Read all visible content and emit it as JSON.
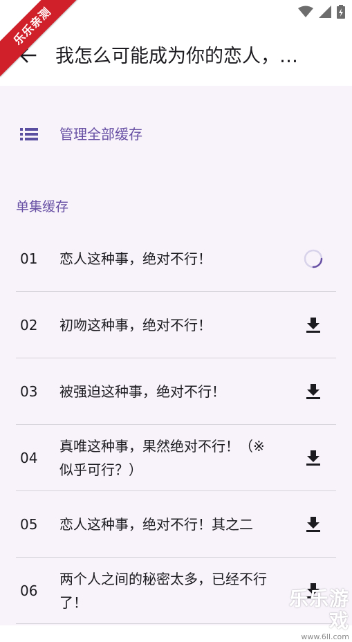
{
  "ribbon": {
    "text": "乐乐亲测"
  },
  "appbar": {
    "title": "我怎么可能成为你的恋人，…"
  },
  "manage": {
    "label": "管理全部缓存"
  },
  "section": {
    "title": "单集缓存"
  },
  "episodes": [
    {
      "num": "01",
      "title": "恋人这种事，绝对不行！",
      "state": "loading"
    },
    {
      "num": "02",
      "title": "初吻这种事，绝对不行！",
      "state": "download"
    },
    {
      "num": "03",
      "title": "被强迫这种事，绝对不行！",
      "state": "download"
    },
    {
      "num": "04",
      "title": "真唯这种事，果然绝对不行！（※似乎可行？）",
      "state": "download"
    },
    {
      "num": "05",
      "title": "恋人这种事，绝对不行！其之二",
      "state": "download"
    },
    {
      "num": "06",
      "title": "两个人之间的秘密太多，已经不行了！",
      "state": "download"
    }
  ],
  "watermark": {
    "main": "乐乐游戏",
    "url": "www.6ll.com"
  },
  "colors": {
    "accent": "#6750a4",
    "background": "#f8f3fb",
    "ribbon": "#d0202a",
    "text": "#1c1b1f"
  },
  "icons": {
    "back": "arrow-left-icon",
    "manage": "list-icon",
    "download": "download-icon",
    "loading": "spinner-icon"
  }
}
